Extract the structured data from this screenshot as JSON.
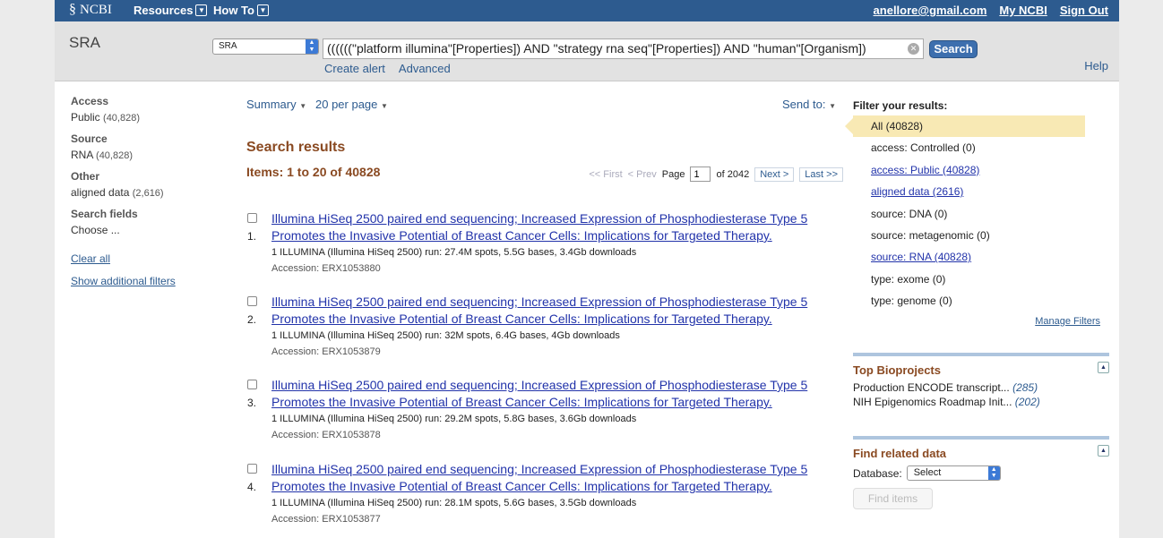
{
  "topbar": {
    "logo": "NCBI",
    "nav": [
      {
        "label": "Resources"
      },
      {
        "label": "How To"
      }
    ],
    "user_email": "anellore@gmail.com",
    "my_ncbi": "My NCBI",
    "sign_out": "Sign Out"
  },
  "search": {
    "db_title": "SRA",
    "db_select": "SRA",
    "query": "((((((\"platform illumina\"[Properties]) AND \"strategy rna seq\"[Properties]) AND \"human\"[Organism])",
    "button": "Search",
    "create_alert": "Create alert",
    "advanced": "Advanced",
    "help": "Help"
  },
  "sidebar": {
    "groups": [
      {
        "heading": "Access",
        "value": "Public",
        "count": "(40,828)"
      },
      {
        "heading": "Source",
        "value": "RNA",
        "count": "(40,828)"
      },
      {
        "heading": "Other",
        "value": "aligned data",
        "count": "(2,616)"
      },
      {
        "heading": "Search fields",
        "value": "Choose ...",
        "count": ""
      }
    ],
    "clear_all": "Clear all",
    "show_filters": "Show additional filters"
  },
  "main": {
    "format": "Summary",
    "per_page": "20 per page",
    "send_to": "Send to:",
    "results_title": "Search results",
    "items_text": "Items: 1 to 20 of 40828",
    "pager": {
      "first": "<< First",
      "prev": "< Prev",
      "page_label": "Page",
      "page": "1",
      "of_text": "of 2042",
      "next": "Next >",
      "last": "Last >>"
    },
    "results": [
      {
        "num": "1.",
        "title": "Illumina HiSeq 2500 paired end sequencing; Increased Expression of Phosphodiesterase Type 5 Promotes the Invasive Potential of Breast Cancer Cells: Implications for Targeted Therapy.",
        "desc": "1 ILLUMINA (Illumina HiSeq 2500) run: 27.4M spots, 5.5G bases, 3.4Gb downloads",
        "accession": "Accession: ERX1053880"
      },
      {
        "num": "2.",
        "title": "Illumina HiSeq 2500 paired end sequencing; Increased Expression of Phosphodiesterase Type 5 Promotes the Invasive Potential of Breast Cancer Cells: Implications for Targeted Therapy.",
        "desc": "1 ILLUMINA (Illumina HiSeq 2500) run: 32M spots, 6.4G bases, 4Gb downloads",
        "accession": "Accession: ERX1053879"
      },
      {
        "num": "3.",
        "title": "Illumina HiSeq 2500 paired end sequencing; Increased Expression of Phosphodiesterase Type 5 Promotes the Invasive Potential of Breast Cancer Cells: Implications for Targeted Therapy.",
        "desc": "1 ILLUMINA (Illumina HiSeq 2500) run: 29.2M spots, 5.8G bases, 3.6Gb downloads",
        "accession": "Accession: ERX1053878"
      },
      {
        "num": "4.",
        "title": "Illumina HiSeq 2500 paired end sequencing; Increased Expression of Phosphodiesterase Type 5 Promotes the Invasive Potential of Breast Cancer Cells: Implications for Targeted Therapy.",
        "desc": "1 ILLUMINA (Illumina HiSeq 2500) run: 28.1M spots, 5.6G bases, 3.5Gb downloads",
        "accession": "Accession: ERX1053877"
      }
    ]
  },
  "filters": {
    "heading": "Filter your results:",
    "items": [
      {
        "label": "All (40828)"
      },
      {
        "label": "access: Controlled (0)"
      },
      {
        "label": "access: Public (40828)"
      },
      {
        "label": "aligned data (2616)"
      },
      {
        "label": "source: DNA (0)"
      },
      {
        "label": "source: metagenomic (0)"
      },
      {
        "label": "source: RNA (40828)"
      },
      {
        "label": "type: exome (0)"
      },
      {
        "label": "type: genome (0)"
      }
    ],
    "manage": "Manage Filters"
  },
  "bioprojects": {
    "heading": "Top Bioprojects",
    "items": [
      {
        "name": "Production ENCODE transcript...",
        "count": "(285)"
      },
      {
        "name": "NIH Epigenomics Roadmap Init...",
        "count": "(202)"
      }
    ]
  },
  "related": {
    "heading": "Find related data",
    "db_label": "Database:",
    "db_select": "Select",
    "button": "Find items"
  }
}
